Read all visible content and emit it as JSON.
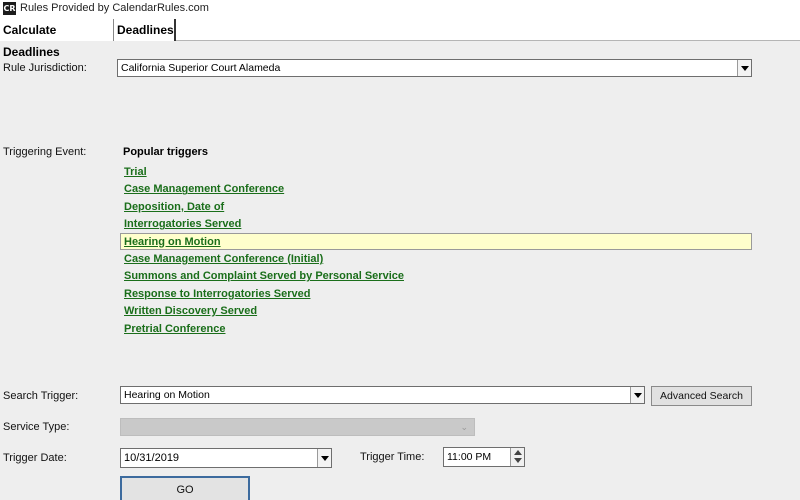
{
  "window": {
    "title": "Rules Provided by CalendarRules.com",
    "logo_text": "CR"
  },
  "tabs": [
    {
      "label": "Calculate Deadlines",
      "active": true
    },
    {
      "label": "Deadlines",
      "active": false
    }
  ],
  "form": {
    "jurisdiction_label": "Rule Jurisdiction:",
    "jurisdiction_value": "California Superior Court Alameda",
    "triggering_event_label": "Triggering Event:",
    "popular_header": "Popular triggers",
    "popular_triggers": [
      "Trial",
      "Case Management Conference",
      "Deposition, Date of",
      "Interrogatories Served",
      "Hearing on Motion",
      "Case Management Conference (Initial)",
      "Summons and Complaint Served by Personal Service",
      "Response to Interrogatories Served",
      "Written Discovery Served",
      "Pretrial Conference"
    ],
    "selected_trigger": "Hearing on Motion",
    "search_trigger_label": "Search Trigger:",
    "search_trigger_value": "Hearing on Motion",
    "advanced_search_label": "Advanced Search",
    "service_type_label": "Service Type:",
    "service_type_value": "",
    "trigger_date_label": "Trigger Date:",
    "trigger_date_value": "10/31/2019",
    "trigger_time_label": "Trigger Time:",
    "trigger_time_value": "11:00 PM",
    "go_label": "GO"
  },
  "colors": {
    "link_green": "#1a6e1a",
    "selected_row": "#ffffcc",
    "go_border": "#3d6b9e"
  }
}
